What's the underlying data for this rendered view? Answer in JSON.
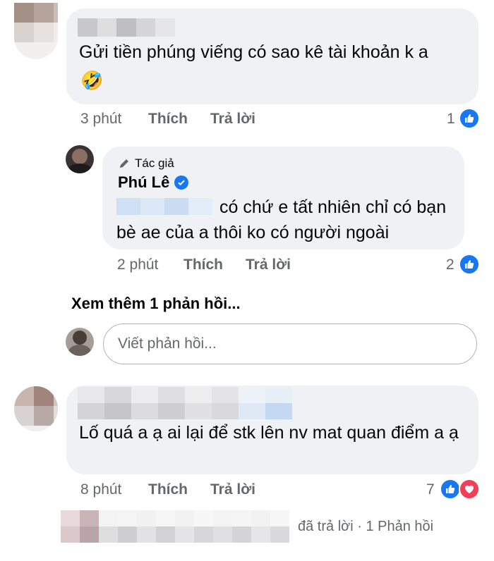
{
  "comments": [
    {
      "text": "Gửi tiền phúng viếng có sao kê tài khoản k a",
      "emoji": "🤣",
      "time": "3 phút",
      "like_label": "Thích",
      "reply_label": "Trả lời",
      "reaction_count": "1"
    },
    {
      "text": "Lố quá a ạ ai lại để stk lên nv mat quan điểm a ạ",
      "time": "8 phút",
      "like_label": "Thích",
      "reply_label": "Trả lời",
      "reaction_count": "7"
    }
  ],
  "reply": {
    "author_badge": "Tác giả",
    "author_name": "Phú Lê",
    "text": "có chứ e tất nhiên chỉ có bạn bè ae của a thôi ko có người ngoài",
    "time": "2 phút",
    "like_label": "Thích",
    "reply_label": "Trả lời",
    "reaction_count": "2"
  },
  "view_more": "Xem thêm 1 phản hồi...",
  "reply_input": {
    "placeholder": "Viết phản hồi..."
  },
  "bottom": {
    "replied_text": "đã trả lời · 1 Phản hồi"
  },
  "colors": {
    "like_blue": "#1877f2",
    "heart_red": "#f33e58",
    "bubble": "#eff1f4",
    "meta_grey": "#65676b"
  }
}
